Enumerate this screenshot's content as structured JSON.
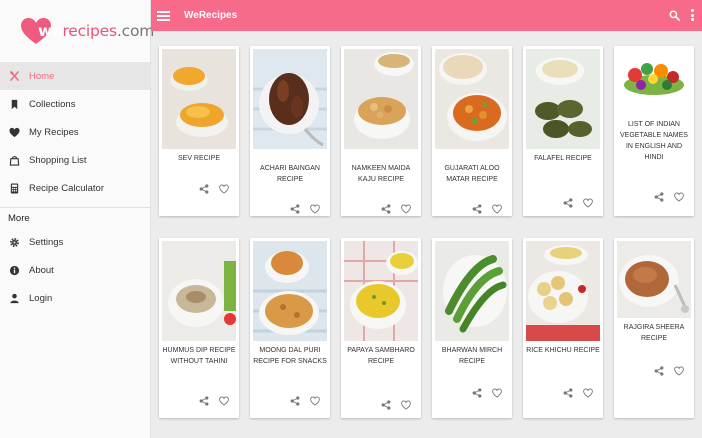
{
  "brand": {
    "we": "we",
    "rest": "recipes",
    "dot": ".com"
  },
  "appbar": {
    "title": "WeRecipes"
  },
  "sidebar": {
    "items": [
      {
        "label": "Home"
      },
      {
        "label": "Collections"
      },
      {
        "label": "My Recipes"
      },
      {
        "label": "Shopping List"
      },
      {
        "label": "Recipe Calculator"
      }
    ],
    "more_header": "More",
    "more_items": [
      {
        "label": "Settings"
      },
      {
        "label": "About"
      },
      {
        "label": "Login"
      }
    ]
  },
  "recipes": [
    {
      "name": "SEV RECIPE"
    },
    {
      "name": "ACHARI BAINGAN RECIPE"
    },
    {
      "name": "NAMKEEN MAIDA KAJU RECIPE"
    },
    {
      "name": "GUJARATI ALOO MATAR RECIPE"
    },
    {
      "name": "FALAFEL RECIPE"
    },
    {
      "name": "LIST OF INDIAN VEGETABLE NAMES IN ENGLISH AND HINDI"
    },
    {
      "name": "HUMMUS DIP RECIPE WITHOUT TAHINI"
    },
    {
      "name": "MOONG DAL PURI RECIPE FOR SNACKS"
    },
    {
      "name": "PAPAYA SAMBHARO RECIPE"
    },
    {
      "name": "BHARWAN MIRCH RECIPE"
    },
    {
      "name": "RICE KHICHU RECIPE"
    },
    {
      "name": "RAJGIRA SHEERA RECIPE"
    }
  ],
  "colors": {
    "accent": "#f76a8a",
    "active": "#f06a84"
  }
}
